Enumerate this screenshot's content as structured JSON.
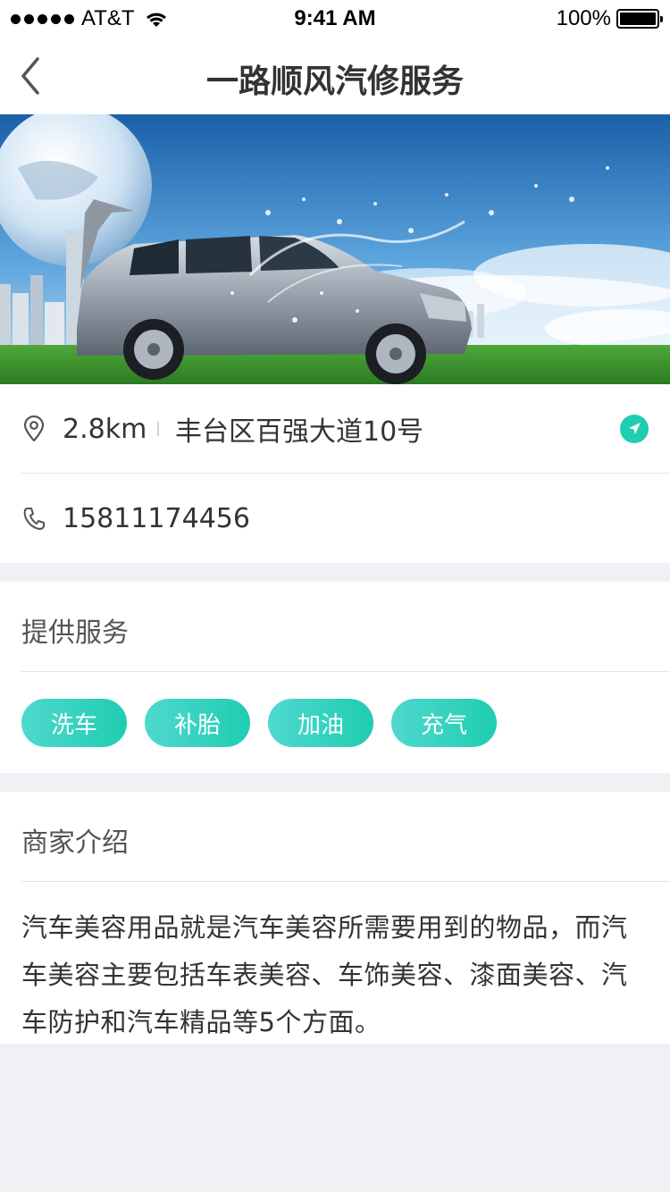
{
  "status_bar": {
    "carrier": "AT&T",
    "time": "9:41 AM",
    "battery": "100%"
  },
  "header": {
    "title": "一路顺风汽修服务"
  },
  "info": {
    "distance": "2.8km",
    "address": "丰台区百强大道10号",
    "phone": "15811174456"
  },
  "services": {
    "title": "提供服务",
    "tags": [
      "洗车",
      "补胎",
      "加油",
      "充气"
    ]
  },
  "intro": {
    "title": "商家介绍",
    "text": "汽车美容用品就是汽车美容所需要用到的物品，而汽车美容主要包括车表美容、车饰美容、漆面美容、汽车防护和汽车精品等5个方面。"
  },
  "colors": {
    "accent": "#1fcdb1",
    "background": "#eff1f4"
  }
}
